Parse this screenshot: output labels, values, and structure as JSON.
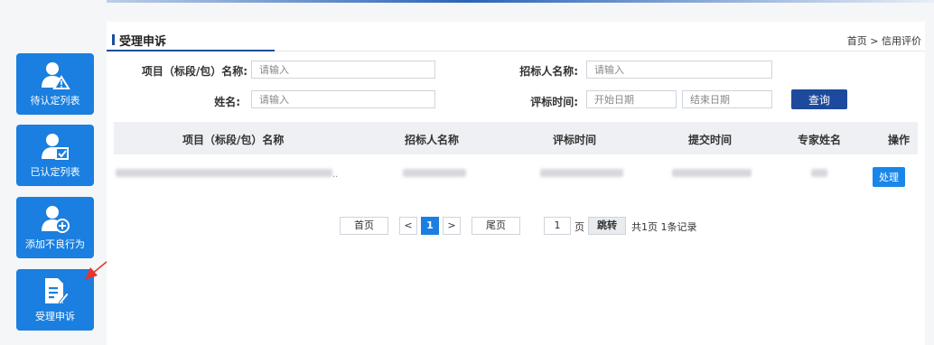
{
  "sidebar": {
    "items": [
      {
        "label": "待认定列表",
        "icon": "user-warning-icon"
      },
      {
        "label": "已认定列表",
        "icon": "user-check-icon"
      },
      {
        "label": "添加不良行为",
        "icon": "user-add-icon"
      },
      {
        "label": "受理申诉",
        "icon": "document-edit-icon"
      }
    ]
  },
  "header": {
    "title": "受理申诉",
    "breadcrumb": "首页 > 信用评价"
  },
  "search": {
    "project_label": "项目（标段/包）名称:",
    "project_placeholder": "请输入",
    "tenderer_label": "招标人名称:",
    "tenderer_placeholder": "请输入",
    "name_label": "姓名:",
    "name_placeholder": "请输入",
    "time_label": "评标时间:",
    "start_placeholder": "开始日期",
    "end_placeholder": "结束日期",
    "query_label": "查询"
  },
  "table": {
    "headers": [
      "项目（标段/包）名称",
      "招标人名称",
      "评标时间",
      "提交时间",
      "专家姓名",
      "操作"
    ],
    "row_action": "处理",
    "ellipsis": ".."
  },
  "pagination": {
    "first": "首页",
    "prev": "<",
    "current": "1",
    "next": ">",
    "last": "尾页",
    "page_input": "1",
    "page_unit": "页",
    "jump": "跳转",
    "summary": "共1页 1条记录"
  },
  "colors": {
    "accent": "#1a7fe0",
    "dark_blue": "#1d4a9c",
    "annotation_arrow": "#e8322e"
  }
}
